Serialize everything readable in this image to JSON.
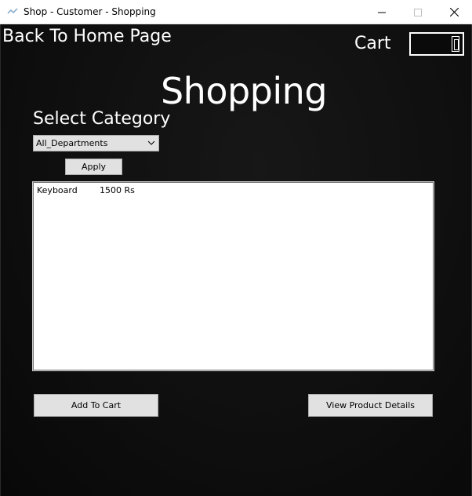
{
  "window": {
    "title": "Shop - Customer - Shopping",
    "controls": {
      "minimize": "minimize-icon",
      "maximize": "maximize-icon",
      "close": "close-icon"
    }
  },
  "header": {
    "back_link": "Back To Home Page",
    "cart_label": "Cart",
    "page_title": "Shopping"
  },
  "filter": {
    "category_label": "Select Category",
    "selected_category": "All_Departments",
    "apply_label": "Apply"
  },
  "products": [
    {
      "name": "Keyboard",
      "price": "1500 Rs"
    }
  ],
  "actions": {
    "add_to_cart": "Add To Cart",
    "view_details": "View Product Details"
  },
  "colors": {
    "background": "#0f0f0f",
    "text": "#ffffff",
    "button": "#e1e1e1"
  }
}
